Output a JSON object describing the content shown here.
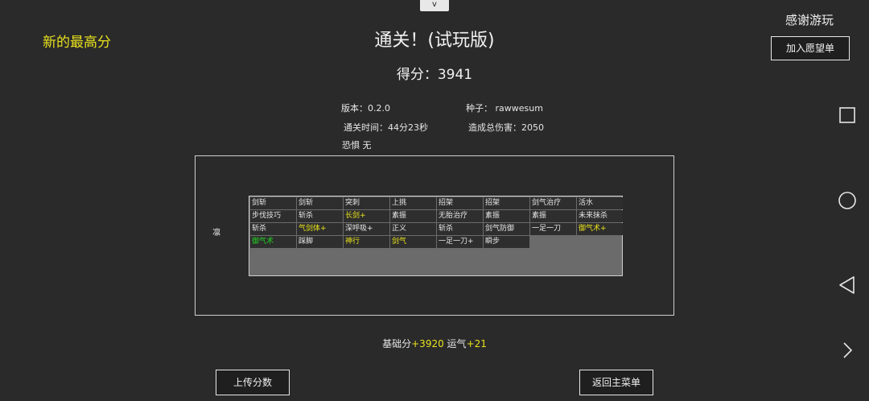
{
  "top_tab": "v",
  "high_score_label": "新的最高分",
  "title": "通关！(试玩版)",
  "score": "得分：3941",
  "thanks": "感谢游玩",
  "wishlist_button": "加入愿望单",
  "info": {
    "version": "版本：0.2.0",
    "seed": "种子：  rawwesum",
    "clear_time": "通关时间：44分23秒",
    "total_damage": "造成总伤害：2050",
    "fear": "恐惧  无"
  },
  "character": "凛",
  "cards": [
    {
      "t": "剑斩",
      "c": "w"
    },
    {
      "t": "剑斩",
      "c": "w"
    },
    {
      "t": "突刺",
      "c": "w"
    },
    {
      "t": "上挑",
      "c": "w"
    },
    {
      "t": "招架",
      "c": "w"
    },
    {
      "t": "招架",
      "c": "w"
    },
    {
      "t": "剑气治疗",
      "c": "w"
    },
    {
      "t": "活水",
      "c": "w"
    },
    {
      "t": "步伐技巧",
      "c": "w"
    },
    {
      "t": "斩杀",
      "c": "w"
    },
    {
      "t": "长剑+",
      "c": "y"
    },
    {
      "t": "素振",
      "c": "w"
    },
    {
      "t": "无胎治疗",
      "c": "w"
    },
    {
      "t": "素振",
      "c": "w"
    },
    {
      "t": "素振",
      "c": "w"
    },
    {
      "t": "未来抹杀",
      "c": "w"
    },
    {
      "t": "斩杀",
      "c": "w"
    },
    {
      "t": "气剑体+",
      "c": "y"
    },
    {
      "t": "深呼吸+",
      "c": "w"
    },
    {
      "t": "正义",
      "c": "w"
    },
    {
      "t": "斩杀",
      "c": "w"
    },
    {
      "t": "剑气防御",
      "c": "w"
    },
    {
      "t": "一足一刀",
      "c": "w"
    },
    {
      "t": "御气术+",
      "c": "y"
    },
    {
      "t": "御气术",
      "c": "g"
    },
    {
      "t": "踩脚",
      "c": "w"
    },
    {
      "t": "神行",
      "c": "y"
    },
    {
      "t": "剑气",
      "c": "y"
    },
    {
      "t": "一足一刀+",
      "c": "w"
    },
    {
      "t": "瞬步",
      "c": "w"
    }
  ],
  "summary": {
    "base_label": "基础分",
    "base_value": "+3920",
    "luck_label": "运气",
    "luck_value": "+21"
  },
  "upload_button": "上传分数",
  "main_menu_button": "返回主菜单",
  "nav_icons": [
    "square-icon",
    "circle-icon",
    "triangle-back-icon",
    "chevron-right-icon"
  ]
}
